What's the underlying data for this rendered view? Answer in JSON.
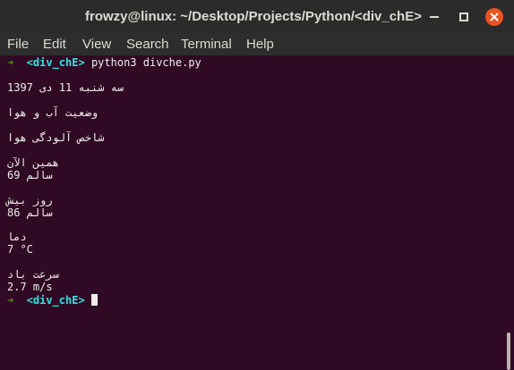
{
  "window": {
    "title": "frowzy@linux: ~/Desktop/Projects/Python/<div_chE>"
  },
  "menu": {
    "items": [
      "File",
      "Edit",
      "View",
      "Search",
      "Terminal",
      "Help"
    ]
  },
  "terminal": {
    "prompt_arrow": "➜",
    "prompt_dir": "<div_chE>",
    "command": "python3 divche.py",
    "output": [
      "1397 سه شنبه 11 دی",
      "وضعیت آب و هوا",
      "شاخص آلودگی هوا",
      "همین الآن",
      "سالم 69",
      "روز بیش",
      "سالم 86",
      "دما",
      "7 °C",
      "سرعت باد",
      "2.7 m/s"
    ]
  },
  "colors": {
    "terminal_bg": "#300a24",
    "prompt_arrow": "#4e9a06",
    "prompt_dir": "#34e2e2",
    "close_button": "#e95420"
  },
  "icons": {
    "close": "close-icon",
    "minimize": "minimize-icon",
    "maximize": "maximize-icon"
  }
}
